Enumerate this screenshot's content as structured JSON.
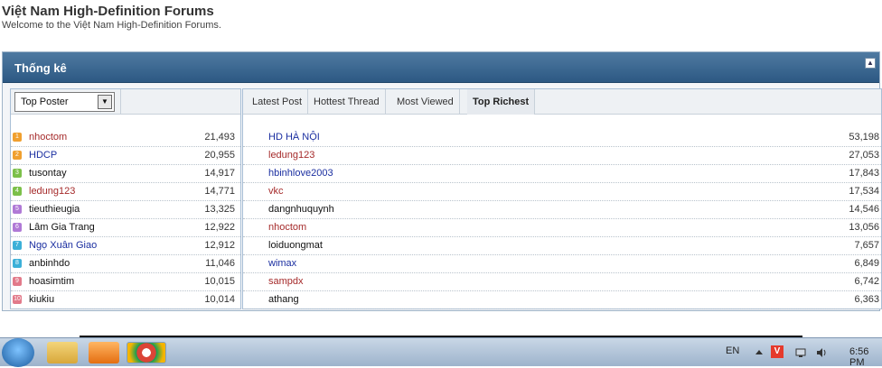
{
  "site": {
    "title": "Việt Nam High-Definition Forums",
    "subtitle": "Welcome to the Việt Nam High-Definition Forums."
  },
  "stats": {
    "title": "Thống kê",
    "collapse_icon": "collapse-icon",
    "left": {
      "select_value": "Top Poster",
      "rows": [
        {
          "rank": "1",
          "name": "nhoctom",
          "value": "21,493",
          "name_color": "#a52a2a",
          "badge_color": "#f0a030"
        },
        {
          "rank": "2",
          "name": "HDCP",
          "value": "20,955",
          "name_color": "#1a2ea0",
          "badge_color": "#f0a030"
        },
        {
          "rank": "3",
          "name": "tusontay",
          "value": "14,917",
          "name_color": "#111111",
          "badge_color": "#7cc04a"
        },
        {
          "rank": "4",
          "name": "ledung123",
          "value": "14,771",
          "name_color": "#a52a2a",
          "badge_color": "#7cc04a"
        },
        {
          "rank": "5",
          "name": "tieuthieugia",
          "value": "13,325",
          "name_color": "#111111",
          "badge_color": "#b07ad6"
        },
        {
          "rank": "6",
          "name": "Lâm Gia Trang",
          "value": "12,922",
          "name_color": "#111111",
          "badge_color": "#b07ad6"
        },
        {
          "rank": "7",
          "name": "Ngọ Xuân Giao",
          "value": "12,912",
          "name_color": "#1a2ea0",
          "badge_color": "#3cb0d8"
        },
        {
          "rank": "8",
          "name": "anbinhdo",
          "value": "11,046",
          "name_color": "#111111",
          "badge_color": "#3cb0d8"
        },
        {
          "rank": "9",
          "name": "hoasimtim",
          "value": "10,015",
          "name_color": "#111111",
          "badge_color": "#e27a8a"
        },
        {
          "rank": "10",
          "name": "kiukiu",
          "value": "10,014",
          "name_color": "#111111",
          "badge_color": "#e27a8a"
        }
      ]
    },
    "right": {
      "tabs": [
        "Latest Post",
        "Hottest Thread",
        "Most Viewed",
        "Top Richest"
      ],
      "active_tab": "Top Richest",
      "rows": [
        {
          "name": "HD HÀ NỘI",
          "value": "53,198",
          "name_color": "#1a2ea0"
        },
        {
          "name": "ledung123",
          "value": "27,053",
          "name_color": "#a52a2a"
        },
        {
          "name": "hbinhlove2003",
          "value": "17,843",
          "name_color": "#1a2ea0"
        },
        {
          "name": "vkc",
          "value": "17,534",
          "name_color": "#a52a2a"
        },
        {
          "name": "dangnhuquynh",
          "value": "14,546",
          "name_color": "#111111"
        },
        {
          "name": "nhoctom",
          "value": "13,056",
          "name_color": "#a52a2a"
        },
        {
          "name": "loiduongmat",
          "value": "7,657",
          "name_color": "#111111"
        },
        {
          "name": "wimax",
          "value": "6,849",
          "name_color": "#1a2ea0"
        },
        {
          "name": "sampdx",
          "value": "6,742",
          "name_color": "#a52a2a"
        },
        {
          "name": "athang",
          "value": "6,363",
          "name_color": "#111111"
        }
      ]
    }
  },
  "taskbar": {
    "lang": "EN",
    "tray_v": "V",
    "clock": "6:56 PM",
    "icons": [
      "windows-start-icon",
      "folder-icon",
      "media-player-icon",
      "chrome-icon"
    ]
  }
}
